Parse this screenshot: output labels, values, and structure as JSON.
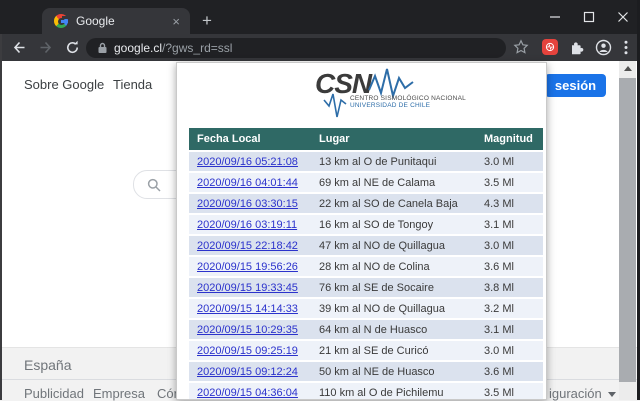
{
  "browser": {
    "tab_title": "Google",
    "url_host": "google.cl",
    "url_path": "/?gws_rd=ssl",
    "new_tab_label": "+",
    "tab_close_label": "×"
  },
  "page": {
    "top_links": [
      "Sobre Google",
      "Tienda"
    ],
    "signin_label": "sesión",
    "footer": {
      "country": "España",
      "links": [
        "Publicidad",
        "Empresa",
        "Cóm"
      ],
      "right_fragment": "iguración"
    }
  },
  "popup": {
    "logo": {
      "acronym": "CSN",
      "line1": "CENTRO SISMOLÓGICO NACIONAL",
      "line2": "UNIVERSIDAD DE CHILE"
    },
    "table": {
      "columns": [
        "Fecha Local",
        "Lugar",
        "Magnitud"
      ],
      "rows": [
        [
          "2020/09/16 05:21:08",
          "13 km al O de Punitaqui",
          "3.0 Ml"
        ],
        [
          "2020/09/16 04:01:44",
          "69 km al NE de Calama",
          "3.5 Ml"
        ],
        [
          "2020/09/16 03:30:15",
          "22 km al SO de Canela Baja",
          "4.3 Ml"
        ],
        [
          "2020/09/16 03:19:11",
          "16 km al SO de Tongoy",
          "3.1 Ml"
        ],
        [
          "2020/09/15 22:18:42",
          "47 km al NO de Quillagua",
          "3.0 Ml"
        ],
        [
          "2020/09/15 19:56:26",
          "28 km al NO de Colina",
          "3.6 Ml"
        ],
        [
          "2020/09/15 19:33:45",
          "76 km al SE de Socaire",
          "3.8 Ml"
        ],
        [
          "2020/09/15 14:14:33",
          "39 km al NO de Quillagua",
          "3.2 Ml"
        ],
        [
          "2020/09/15 10:29:35",
          "64 km al N de Huasco",
          "3.1 Ml"
        ],
        [
          "2020/09/15 09:25:19",
          "21 km al SE de Curicó",
          "3.0 Ml"
        ],
        [
          "2020/09/15 09:12:24",
          "50 km al NE de Huasco",
          "3.6 Ml"
        ],
        [
          "2020/09/15 04:36:04",
          "110 km al O de Pichilemu",
          "3.5 Ml"
        ]
      ]
    }
  },
  "colors": {
    "accent_blue": "#1a73e8",
    "table_header_teal": "#2f6965",
    "row_odd": "#dbe2ee",
    "row_even": "#eef2f9",
    "link_blue": "#2b32cc",
    "extension_red": "#e5433d",
    "chrome_dark": "#202124",
    "toolbar_dark": "#35363a"
  }
}
